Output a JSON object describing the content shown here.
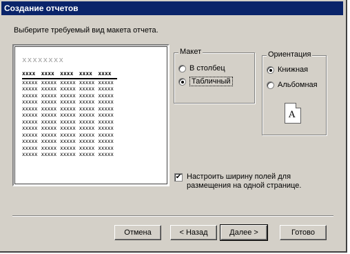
{
  "window": {
    "title": "Создание отчетов"
  },
  "instruction": "Выберите требуемый вид макета отчета.",
  "preview": {
    "title_placeholder": "xxxxxxxx",
    "header_cells": [
      "xxxx",
      "xxxx",
      "xxxx",
      "xxxx",
      "xxxx"
    ],
    "cell_text": "xxxxx",
    "row_count": 12
  },
  "layout_group": {
    "label": "Макет",
    "options": [
      {
        "label": "В столбец",
        "selected": false
      },
      {
        "label": "Табличный",
        "selected": true
      }
    ]
  },
  "orientation_group": {
    "label": "Ориентация",
    "options": [
      {
        "label": "Книжная",
        "selected": true
      },
      {
        "label": "Альбомная",
        "selected": false
      }
    ],
    "page_letter": "A"
  },
  "fit_checkbox": {
    "label": "Настроить ширину полей для размещения на одной странице.",
    "checked": true
  },
  "buttons": {
    "cancel": "Отмена",
    "back": "< Назад",
    "next": "Далее >",
    "finish": "Готово"
  }
}
